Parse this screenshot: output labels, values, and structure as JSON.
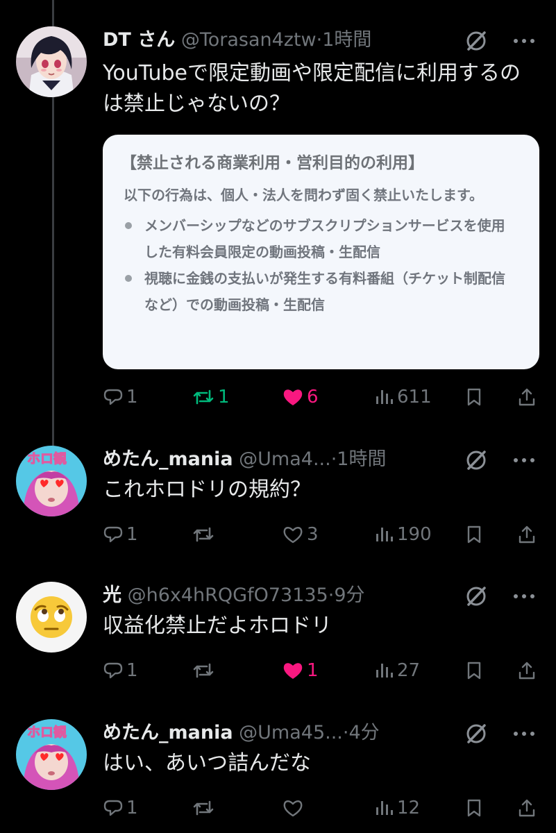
{
  "tweets": [
    {
      "name": "DT さん",
      "handle": "@Torasan4ztw",
      "dot": "·",
      "time": "1時間",
      "text": "YouTubeで限定動画や限定配信に利用するのは禁止じゃないの？",
      "card": {
        "title": "【禁止される商業利用・営利目的の利用】",
        "intro": "以下の行為は、個人・法人を問わず固く禁止いたします。",
        "bullets": [
          "メンバーシップなどのサブスクリプションサービスを使用した有料会員限定の動画投稿・生配信",
          "視聴に金銭の支払いが発生する有料番組（チケット制配信など）での動画投稿・生配信"
        ]
      },
      "replies": "1",
      "retweets": "1",
      "likes": "6",
      "views": "611",
      "liked": true,
      "retweeted": true
    },
    {
      "name": "めたん_mania",
      "handle": "@Uma4...",
      "dot": "·",
      "time": "1時間",
      "text": "これホロドリの規約？",
      "replies": "1",
      "retweets": "",
      "likes": "3",
      "views": "190",
      "liked": false,
      "retweeted": false
    },
    {
      "name": "光",
      "handle": "@h6x4hRQGfO73135",
      "dot": "·",
      "time": "9分",
      "text": "収益化禁止だよホロドリ",
      "replies": "1",
      "retweets": "",
      "likes": "1",
      "views": "27",
      "liked": true,
      "retweeted": false
    },
    {
      "name": "めたん_mania",
      "handle": "@Uma45...",
      "dot": "·",
      "time": "4分",
      "text": "はい、あいつ詰んだな",
      "replies": "1",
      "retweets": "",
      "likes": "",
      "views": "12",
      "liked": false,
      "retweeted": false
    }
  ],
  "avatar_badge": "ホロ観",
  "colors": {
    "like": "#f91880",
    "retweet": "#00ba7c",
    "muted": "#71767b",
    "text": "#e7e9ea",
    "background": "#000000"
  }
}
